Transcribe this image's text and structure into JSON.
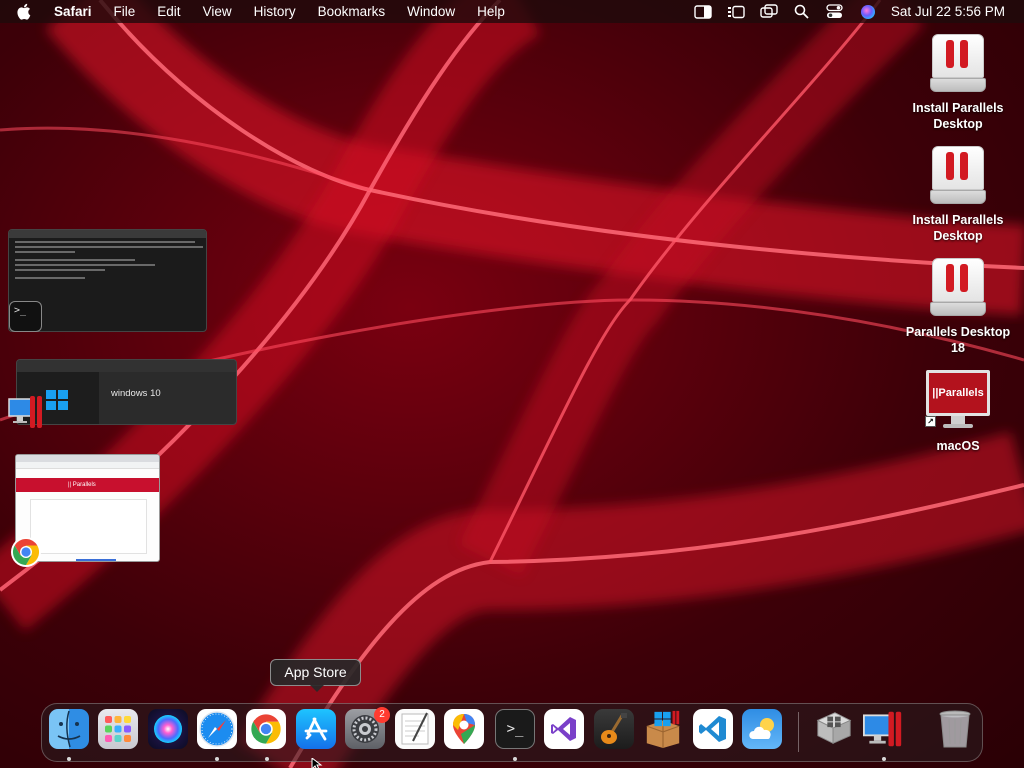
{
  "menubar": {
    "apple_icon": "apple-logo-icon",
    "app_name": "Safari",
    "menus": [
      "File",
      "Edit",
      "View",
      "History",
      "Bookmarks",
      "Window",
      "Help"
    ],
    "status_icons": [
      "sidebar-icon",
      "stage-manager-icon",
      "screen-mirroring-icon",
      "spotlight-search-icon",
      "control-center-icon",
      "siri-icon"
    ],
    "clock": "Sat Jul 22  5:56 PM"
  },
  "desktop": {
    "icons": [
      {
        "label": "Install Parallels Desktop",
        "kind": "disk-image"
      },
      {
        "label": "Install Parallels Desktop",
        "kind": "disk-image"
      },
      {
        "label": "Parallels Desktop 18",
        "kind": "disk-image"
      },
      {
        "label": "macOS",
        "kind": "parallels-vm-alias",
        "screen_text": "||Parallels"
      }
    ]
  },
  "minimized_windows": {
    "parallels_vm_name": "windows 10",
    "chrome_banner": "|| Parallels"
  },
  "tooltip": {
    "text": "App Store"
  },
  "dock": {
    "items": [
      {
        "name": "Finder",
        "icon": "finder-icon",
        "running": true
      },
      {
        "name": "Launchpad",
        "icon": "launchpad-icon",
        "running": false
      },
      {
        "name": "Siri",
        "icon": "siri-icon",
        "running": false
      },
      {
        "name": "Safari",
        "icon": "safari-icon",
        "running": true
      },
      {
        "name": "Google Chrome",
        "icon": "chrome-icon",
        "running": true
      },
      {
        "name": "App Store",
        "icon": "app-store-icon",
        "running": false
      },
      {
        "name": "System Settings",
        "icon": "system-settings-icon",
        "running": false
      },
      {
        "name": "TextEdit",
        "icon": "textedit-icon",
        "running": false
      },
      {
        "name": "Google Maps",
        "icon": "google-maps-icon",
        "running": false
      },
      {
        "name": "Terminal",
        "icon": "terminal-icon",
        "running": true
      },
      {
        "name": "Visual Studio",
        "icon": "visual-studio-icon",
        "running": false
      },
      {
        "name": "GarageBand",
        "icon": "garageband-icon",
        "running": false
      },
      {
        "name": "Windows Installer",
        "icon": "windows-installer-icon",
        "running": false
      },
      {
        "name": "Visual Studio Code",
        "icon": "vscode-icon",
        "running": false
      },
      {
        "name": "Weather",
        "icon": "weather-icon",
        "running": false
      },
      {
        "name": "Boot Camp Assistant",
        "icon": "boot-camp-icon",
        "running": false
      },
      {
        "name": "Parallels Desktop",
        "icon": "parallels-desktop-icon",
        "running": true
      },
      {
        "name": "Trash",
        "icon": "trash-icon",
        "running": false
      }
    ],
    "settings_badge": "2"
  },
  "colors": {
    "wallpaper_red": "#e0142a",
    "parallels_red": "#d21a22",
    "badge_red": "#ff3b30"
  }
}
